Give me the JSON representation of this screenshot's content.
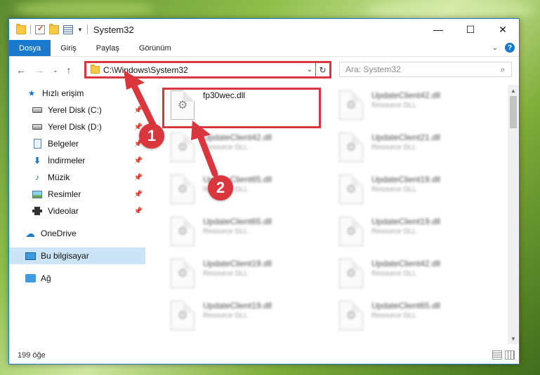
{
  "window": {
    "title": "System32",
    "controls": {
      "minimize": "—",
      "maximize": "☐",
      "close": "✕"
    }
  },
  "ribbon": {
    "tabs": [
      "Dosya",
      "Giriş",
      "Paylaş",
      "Görünüm"
    ],
    "expand": "⌄",
    "help": "?"
  },
  "nav": {
    "back": "←",
    "forward": "→",
    "recent": "⌄",
    "up": "↑"
  },
  "address": {
    "path": "C:\\Windows\\System32",
    "dropdown": "⌄",
    "refresh": "↻"
  },
  "search": {
    "placeholder": "Ara: System32",
    "icon": "search-icon"
  },
  "sidebar": {
    "items": [
      {
        "label": "Hızlı erişim",
        "icon": "star-icon",
        "pinned": false
      },
      {
        "label": "Yerel Disk (C:)",
        "icon": "disk-icon",
        "pinned": true
      },
      {
        "label": "Yerel Disk (D:)",
        "icon": "disk-icon",
        "pinned": true
      },
      {
        "label": "Belgeler",
        "icon": "document-icon",
        "pinned": true
      },
      {
        "label": "İndirmeler",
        "icon": "download-icon",
        "pinned": true
      },
      {
        "label": "Müzik",
        "icon": "music-icon",
        "pinned": true
      },
      {
        "label": "Resimler",
        "icon": "picture-icon",
        "pinned": true
      },
      {
        "label": "Videolar",
        "icon": "video-icon",
        "pinned": true
      },
      {
        "label": "OneDrive",
        "icon": "cloud-icon",
        "pinned": false
      },
      {
        "label": "Bu bilgisayar",
        "icon": "computer-icon",
        "pinned": false,
        "selected": true
      },
      {
        "label": "Ağ",
        "icon": "network-icon",
        "pinned": false
      }
    ]
  },
  "files": [
    {
      "name": "fp30wec.dll",
      "type": "",
      "highlighted": true
    },
    {
      "name": "UpdateClient42.dll",
      "type": "Resource DLL"
    },
    {
      "name": "UpdateClient42.dll",
      "type": "Resource DLL"
    },
    {
      "name": "UpdateClient21.dll",
      "type": "Resource DLL"
    },
    {
      "name": "UpdateClient65.dll",
      "type": "Resource DLL"
    },
    {
      "name": "UpdateClient19.dll",
      "type": "Resource DLL"
    },
    {
      "name": "UpdateClient65.dll",
      "type": "Resource DLL"
    },
    {
      "name": "UpdateClient19.dll",
      "type": "Resource DLL"
    },
    {
      "name": "UpdateClient19.dll",
      "type": "Resource DLL"
    },
    {
      "name": "UpdateClient42.dll",
      "type": "Resource DLL"
    },
    {
      "name": "UpdateClient19.dll",
      "type": "Resource DLL"
    },
    {
      "name": "UpdateClient65.dll",
      "type": "Resource DLL"
    }
  ],
  "status": {
    "count": "199 öğe"
  },
  "callouts": [
    "1",
    "2"
  ],
  "colors": {
    "accent": "#1979ca",
    "callout": "#d9363e",
    "selected": "#cce4f7"
  }
}
